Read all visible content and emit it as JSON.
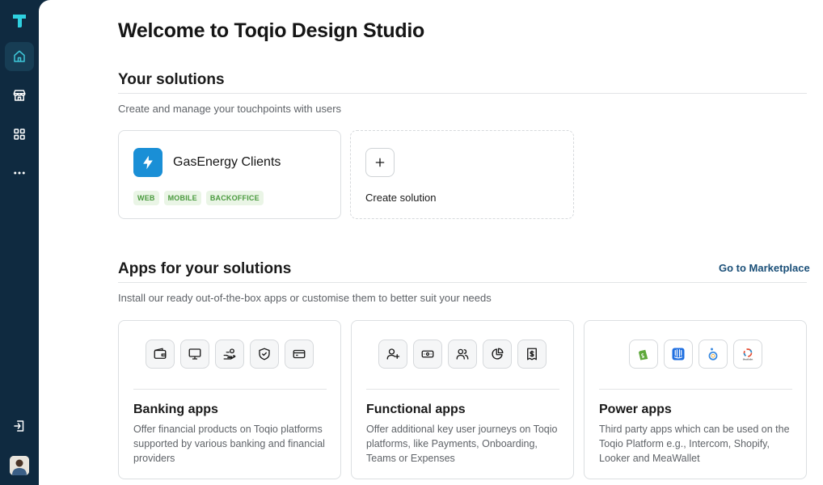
{
  "header": {
    "title": "Welcome to Toqio Design Studio"
  },
  "sidebar": {
    "items": [
      {
        "name": "home",
        "icon": "home-icon",
        "active": true
      },
      {
        "name": "store",
        "icon": "store-icon",
        "active": false
      },
      {
        "name": "apps",
        "icon": "grid-icon",
        "active": false
      },
      {
        "name": "more",
        "icon": "more-icon",
        "active": false
      }
    ],
    "bottom": [
      {
        "name": "logout",
        "icon": "logout-icon"
      },
      {
        "name": "avatar",
        "icon": "avatar"
      }
    ]
  },
  "solutions": {
    "title": "Your solutions",
    "subtitle": "Create and manage your touchpoints with users",
    "card": {
      "name": "GasEnergy Clients",
      "tags": [
        "WEB",
        "MOBILE",
        "BACKOFFICE"
      ]
    },
    "create_label": "Create solution"
  },
  "apps": {
    "title": "Apps for your solutions",
    "link": "Go to Marketplace",
    "subtitle": "Install our ready out-of-the-box apps or customise them to better suit your needs",
    "cards": [
      {
        "title": "Banking apps",
        "description": "Offer financial products on Toqio platforms supported by various banking and financial providers",
        "icons": [
          "wallet-icon",
          "monitor-icon",
          "cash-hand-icon",
          "shield-icon",
          "card-icon"
        ]
      },
      {
        "title": "Functional apps",
        "description": "Offer additional key user journeys on Toqio platforms, like Payments, Onboarding, Teams or Expenses",
        "icons": [
          "user-plus-icon",
          "banknote-icon",
          "users-icon",
          "pie-chart-icon",
          "receipt-icon"
        ]
      },
      {
        "title": "Power apps",
        "description": "Third party apps which can be used on the Toqio Platform e.g., Intercom, Shopify, Looker and MeaWallet",
        "icons": [
          "shopify-icon",
          "intercom-icon",
          "looker-icon",
          "meawallet-icon"
        ],
        "meawallet_text": "MeaWallet"
      }
    ]
  },
  "colors": {
    "sidebar": "#0f2a40",
    "accent": "#1a8fd6",
    "tag_text": "#4a9a3e",
    "tag_bg": "#eaf5e6",
    "link": "#1a4f78"
  }
}
